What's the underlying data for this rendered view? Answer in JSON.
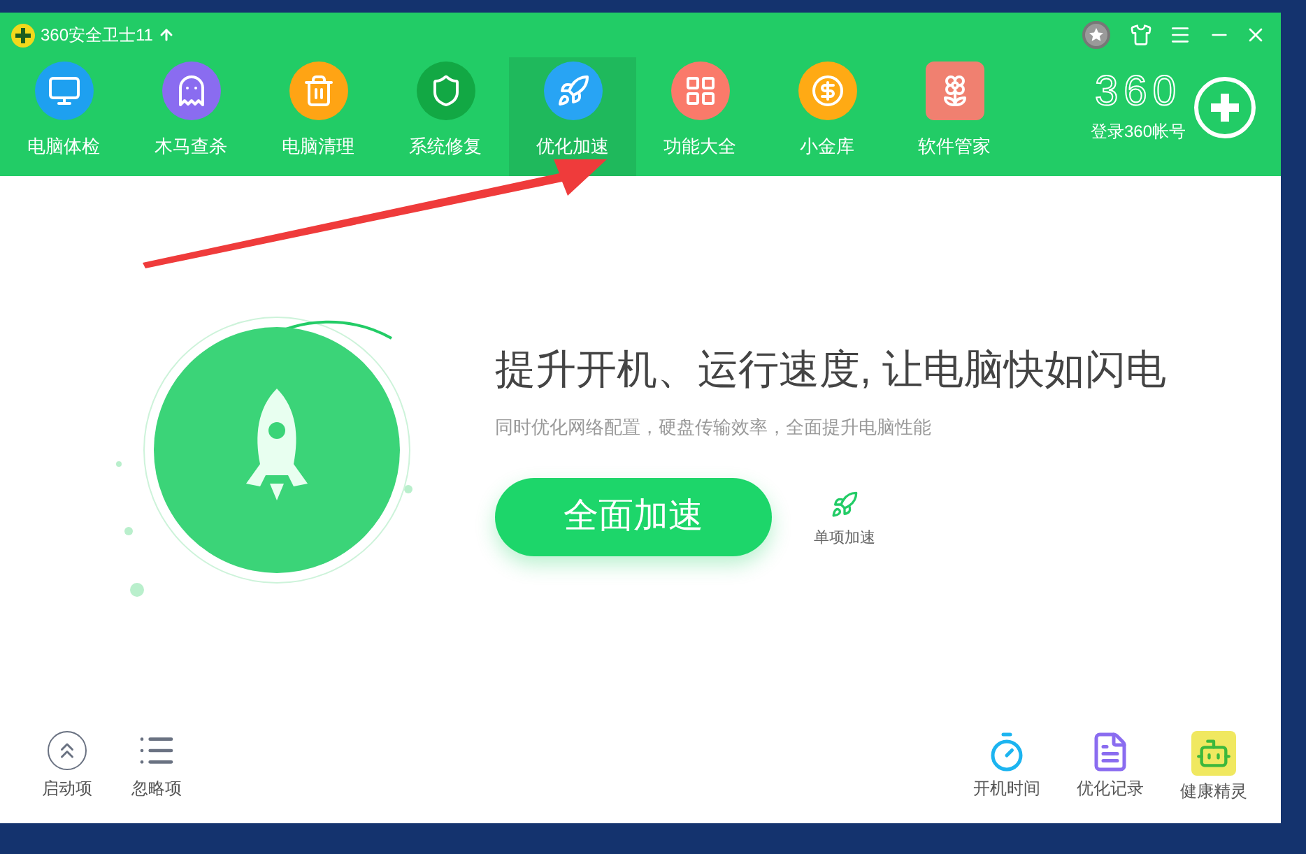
{
  "window": {
    "title": "360安全卫士11"
  },
  "tabs": [
    {
      "label": "电脑体检",
      "color": "#1ea0f0",
      "selected": false
    },
    {
      "label": "木马查杀",
      "color": "#8a6cf0",
      "selected": false
    },
    {
      "label": "电脑清理",
      "color": "#ffa414",
      "selected": false
    },
    {
      "label": "系统修复",
      "color": "#12a844",
      "selected": false
    },
    {
      "label": "优化加速",
      "color": "#28a4f4",
      "selected": true
    },
    {
      "label": "功能大全",
      "color": "#fa7a6a",
      "selected": false
    },
    {
      "label": "小金库",
      "color": "#ffaa14",
      "selected": false
    },
    {
      "label": "软件管家",
      "color": "#f08070",
      "selected": false
    }
  ],
  "account": {
    "logo": "360",
    "label": "登录360帐号"
  },
  "hero": {
    "headline": "提升开机、运行速度, 让电脑快如闪电",
    "subtitle": "同时优化网络配置，硬盘传输效率，全面提升电脑性能",
    "button": "全面加速",
    "secondary": "单项加速"
  },
  "bottom_left": [
    {
      "label": "启动项",
      "kind": "startup"
    },
    {
      "label": "忽略项",
      "kind": "ignore"
    }
  ],
  "bottom_right": [
    {
      "label": "开机时间",
      "kind": "timer"
    },
    {
      "label": "优化记录",
      "kind": "record"
    },
    {
      "label": "健康精灵",
      "kind": "sprite"
    }
  ]
}
